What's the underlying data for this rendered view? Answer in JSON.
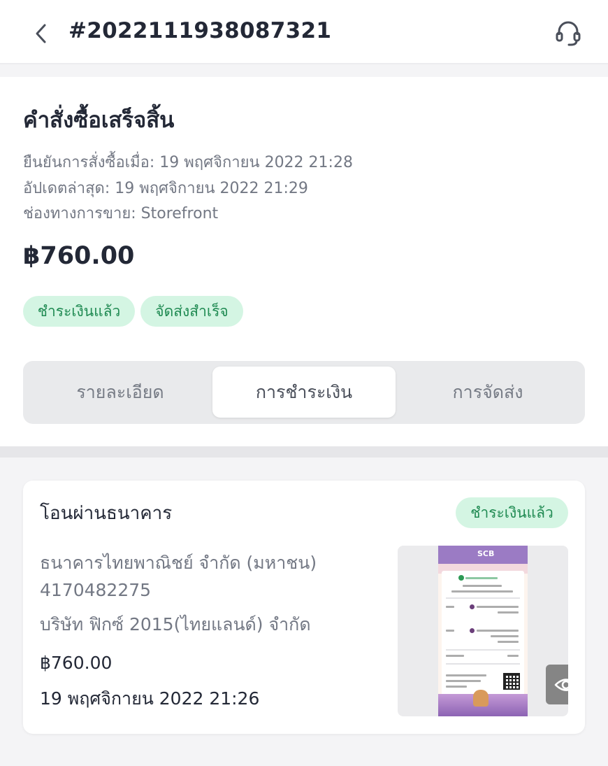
{
  "header": {
    "order_number": "#2022111938087321",
    "back_icon": "chevron-left-icon",
    "support_icon": "headset-icon"
  },
  "summary": {
    "status_title": "คำสั่งซื้อเสร็จสิ้น",
    "confirmed_at": "ยืนยันการสั่งซื้อเมื่อ: 19 พฤศจิกายน 2022 21:28",
    "updated_at": "อัปเดตล่าสุด: 19 พฤศจิกายน 2022 21:29",
    "sales_channel": "ช่องทางการขาย: Storefront",
    "total": "฿760.00",
    "badges": [
      "ชำระเงินแล้ว",
      "จัดส่งสำเร็จ"
    ]
  },
  "tabs": [
    {
      "label": "รายละเอียด",
      "active": false
    },
    {
      "label": "การชำระเงิน",
      "active": true
    },
    {
      "label": "การจัดส่ง",
      "active": false
    }
  ],
  "payment": {
    "method": "โอนผ่านธนาคาร",
    "status_badge": "ชำระเงินแล้ว",
    "bank_name": "ธนาคารไทยพาณิชย์ จำกัด (มหาชน)",
    "account_number": "4170482275",
    "account_name": "บริษัท ฟิกซ์ 2015(ไทยแลนด์) จำกัด",
    "amount": "฿760.00",
    "paid_at": "19 พฤศจิกายน 2022 21:26",
    "slip_bank_logo": "SCB",
    "view_icon": "eye-icon"
  },
  "colors": {
    "badge_bg": "#d4f5e3",
    "badge_text": "#1f8a52",
    "tab_bg": "#e9eaec",
    "page_bg": "#f4f4f6"
  }
}
